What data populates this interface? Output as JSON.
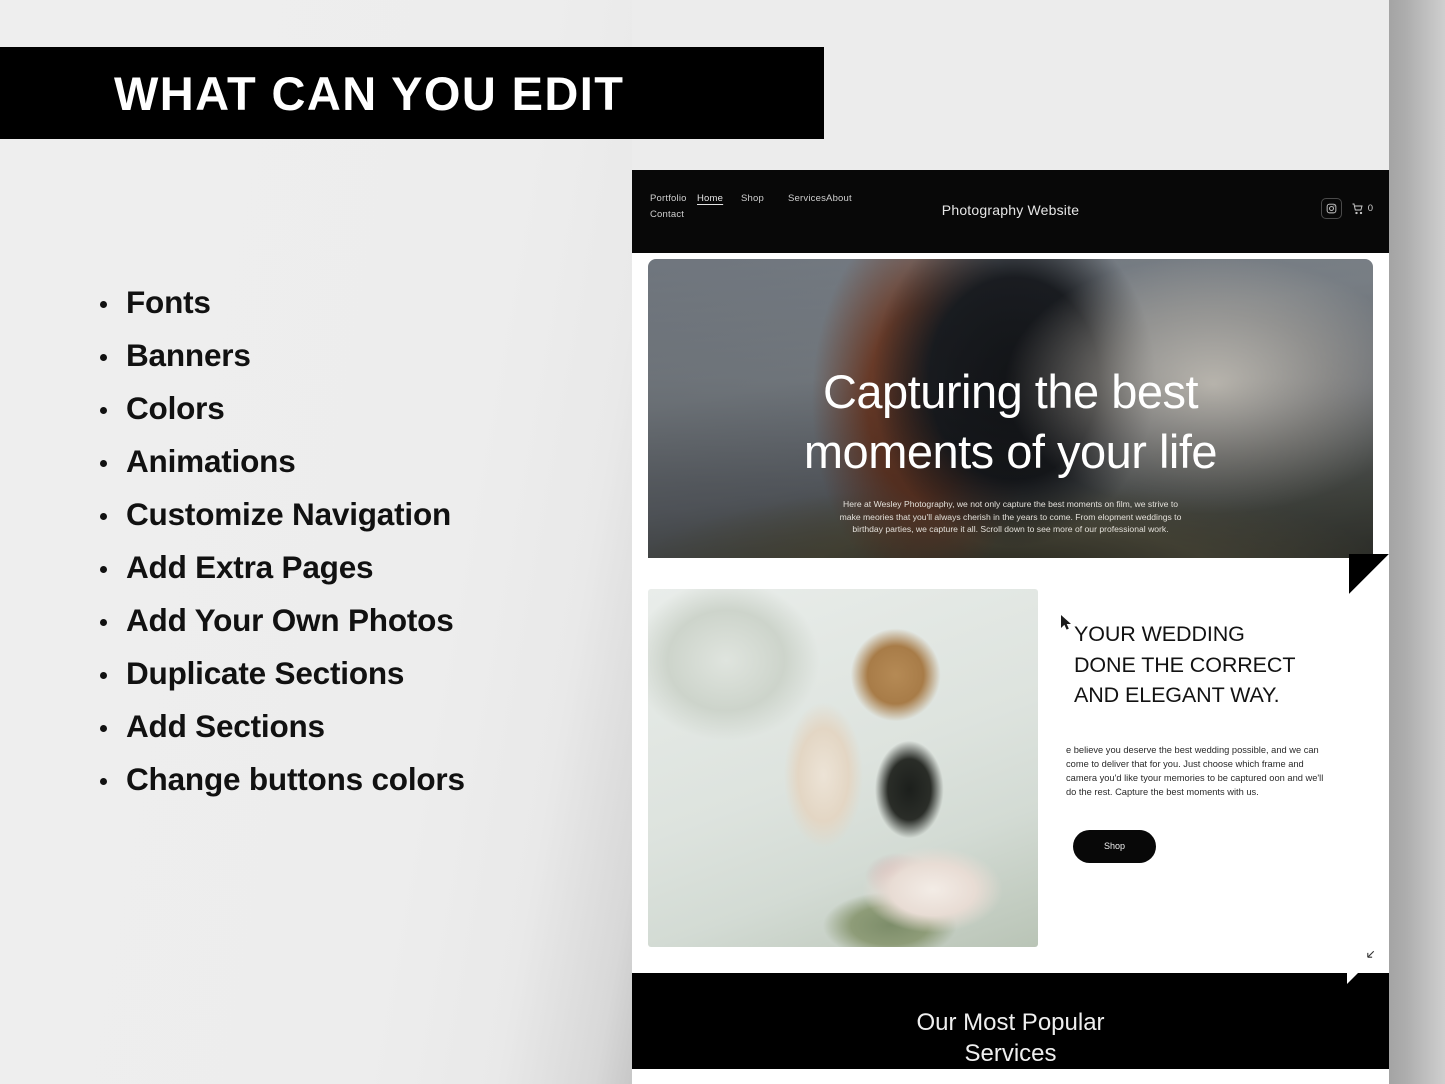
{
  "banner": {
    "title": "WHAT CAN YOU EDIT"
  },
  "features": {
    "items": [
      "Fonts",
      "Banners",
      "Colors",
      "Animations",
      "Customize Navigation",
      "Add Extra Pages",
      "Add Your Own Photos",
      "Duplicate Sections",
      "Add Sections",
      "Change buttons colors"
    ]
  },
  "site": {
    "nav": [
      {
        "label": "Portfolio",
        "active": false
      },
      {
        "label": "Home",
        "active": true
      },
      {
        "label": "Shop",
        "active": false
      },
      {
        "label": "Services",
        "active": false
      },
      {
        "label": "About",
        "active": false
      },
      {
        "label": "Contact",
        "active": false
      }
    ],
    "title": "Photography Website",
    "cart_count": "0",
    "hero": {
      "heading_line1": "Capturing the best",
      "heading_line2": "moments of your life",
      "paragraph": "Here at Wesley Photography, we not only capture the best moments on film, we strive to make meories that you'll always cherish in the years to come. From elopment weddings to birthday parties, we capture it all. Scroll down to see more of our professional work."
    },
    "feature": {
      "heading_line1": "YOUR WEDDING",
      "heading_line2": "DONE THE CORRECT",
      "heading_line3": "AND ELEGANT WAY.",
      "paragraph": "e believe you deserve the best wedding possible, and we can come to deliver that for you. Just choose which frame and camera you'd like tyour memories to be captured oon and we'll do the rest. Capture the best moments with us.",
      "button_label": "Shop"
    },
    "services": {
      "heading_line1": "Our Most Popular",
      "heading_line2": "Services"
    }
  },
  "colors": {
    "black": "#000000",
    "page_bg": "#ececec",
    "text": "#111111"
  }
}
